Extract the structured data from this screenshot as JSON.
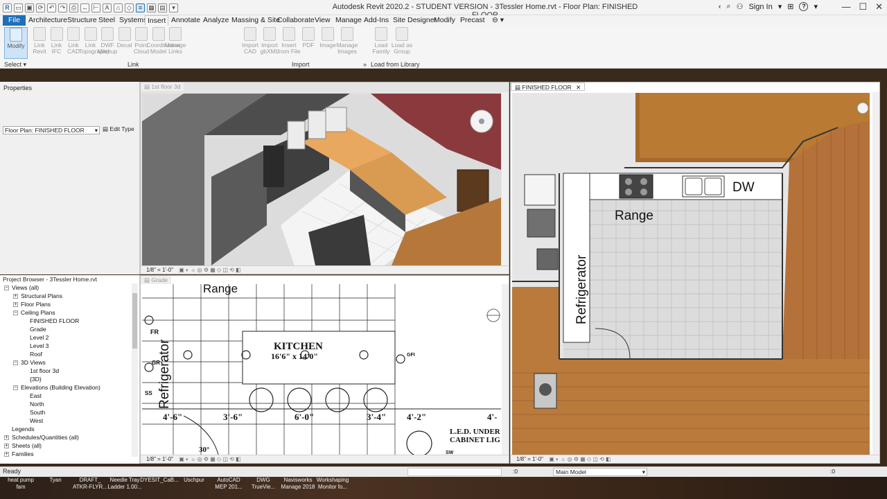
{
  "titlebar": {
    "title": "Autodesk Revit 2020.2 - STUDENT VERSION - 3Tessler Home.rvt - Floor Plan: FINISHED FLOOR",
    "sign_in": "Sign In",
    "help": "?"
  },
  "tabs": [
    "File",
    "Architecture",
    "Structure",
    "Steel",
    "Systems",
    "Insert",
    "Annotate",
    "Analyze",
    "Massing & Site",
    "Collaborate",
    "View",
    "Manage",
    "Add-Ins",
    "Site Designer",
    "Modify",
    "Precast"
  ],
  "active_tab": "Insert",
  "ribbon": {
    "modify": "Modify",
    "select": "Select",
    "link_group": [
      {
        "l1": "Link",
        "l2": "Revit"
      },
      {
        "l1": "Link",
        "l2": "IFC"
      },
      {
        "l1": "Link",
        "l2": "CAD"
      },
      {
        "l1": "Link",
        "l2": "Topography"
      },
      {
        "l1": "DWF",
        "l2": "Markup"
      },
      {
        "l1": "Decal",
        "l2": ""
      },
      {
        "l1": "Point",
        "l2": "Cloud"
      },
      {
        "l1": "Coordination",
        "l2": "Model"
      },
      {
        "l1": "Manage",
        "l2": "Links"
      }
    ],
    "import_group": [
      {
        "l1": "Import",
        "l2": "CAD"
      },
      {
        "l1": "Import",
        "l2": "gbXML"
      },
      {
        "l1": "Insert",
        "l2": "from File"
      },
      {
        "l1": "PDF",
        "l2": ""
      },
      {
        "l1": "Image",
        "l2": ""
      },
      {
        "l1": "Manage",
        "l2": "Images"
      }
    ],
    "library_group": [
      {
        "l1": "Load",
        "l2": "Family"
      },
      {
        "l1": "Load as",
        "l2": "Group"
      }
    ],
    "panel_link": "Link",
    "panel_import": "Import",
    "panel_library": "Load from Library"
  },
  "properties": {
    "title": "Properties",
    "type_select": "Floor Plan: FINISHED FLOOR",
    "edit_type": "Edit Type"
  },
  "browser": {
    "title": "Project Browser - 3Tessler Home.rvt",
    "items": [
      {
        "label": "Views (all)",
        "level": 0,
        "exp": "−"
      },
      {
        "label": "Structural Plans",
        "level": 1,
        "exp": "+"
      },
      {
        "label": "Floor Plans",
        "level": 1,
        "exp": "+"
      },
      {
        "label": "Ceiling Plans",
        "level": 1,
        "exp": "−"
      },
      {
        "label": "FINISHED FLOOR",
        "level": 2,
        "exp": ""
      },
      {
        "label": "Grade",
        "level": 2,
        "exp": ""
      },
      {
        "label": "Level 2",
        "level": 2,
        "exp": ""
      },
      {
        "label": "Level 3",
        "level": 2,
        "exp": ""
      },
      {
        "label": "Roof",
        "level": 2,
        "exp": ""
      },
      {
        "label": "3D Views",
        "level": 1,
        "exp": "−"
      },
      {
        "label": "1st floor 3d",
        "level": 2,
        "exp": ""
      },
      {
        "label": "{3D}",
        "level": 2,
        "exp": ""
      },
      {
        "label": "Elevations (Building Elevation)",
        "level": 1,
        "exp": "−"
      },
      {
        "label": "East",
        "level": 2,
        "exp": ""
      },
      {
        "label": "North",
        "level": 2,
        "exp": ""
      },
      {
        "label": "South",
        "level": 2,
        "exp": ""
      },
      {
        "label": "West",
        "level": 2,
        "exp": ""
      },
      {
        "label": "Legends",
        "level": 0,
        "exp": ""
      },
      {
        "label": "Schedules/Quantities (all)",
        "level": 0,
        "exp": "+"
      },
      {
        "label": "Sheets (all)",
        "level": 0,
        "exp": "+"
      },
      {
        "label": "Families",
        "level": 0,
        "exp": "+"
      }
    ]
  },
  "views": {
    "v3d_tab": "1st floor 3d",
    "grade_tab": "Grade",
    "finished_tab": "FINISHED FLOOR",
    "scale": "1/8\" = 1'-0\""
  },
  "plan_labels": {
    "range": "Range",
    "refrigerator": "Refrigerator",
    "dw": "DW",
    "kitchen": "KITCHEN",
    "kitchen_size": "16'6\" x 14'0\"",
    "dim1": "4'-6\"",
    "dim2": "3'-6\"",
    "dim3": "6'-0\"",
    "dim4": "3'-4\"",
    "dim5": "4'-2\"",
    "dim6": "4'-",
    "angle": "30°",
    "led1": "L.E.D. UNDER",
    "led2": "CABINET LIG",
    "gfi": "GFI",
    "fr": "FR",
    "gr": "GR",
    "ss": "SS",
    "sw": "SW"
  },
  "status": {
    "ready": "Ready",
    "zero": ":0",
    "model": "Main Model",
    "filter": ":0"
  },
  "taskbar": [
    {
      "l1": "heat pump",
      "l2": "fam"
    },
    {
      "l1": "Tyan",
      "l2": ""
    },
    {
      "l1": "DRAFT_",
      "l2": "ATKR-FLYR..."
    },
    {
      "l1": "Needle Tray",
      "l2": "Ladder 1.00..."
    },
    {
      "l1": "DYESIT_CaB...",
      "l2": ""
    },
    {
      "l1": "Uschpur",
      "l2": ""
    },
    {
      "l1": "AutoCAD",
      "l2": "MEP 201..."
    },
    {
      "l1": "DWG",
      "l2": "TrueVie..."
    },
    {
      "l1": "Navisworks",
      "l2": "Manage 2018"
    },
    {
      "l1": "Workshaping",
      "l2": "Monitor fo..."
    }
  ]
}
